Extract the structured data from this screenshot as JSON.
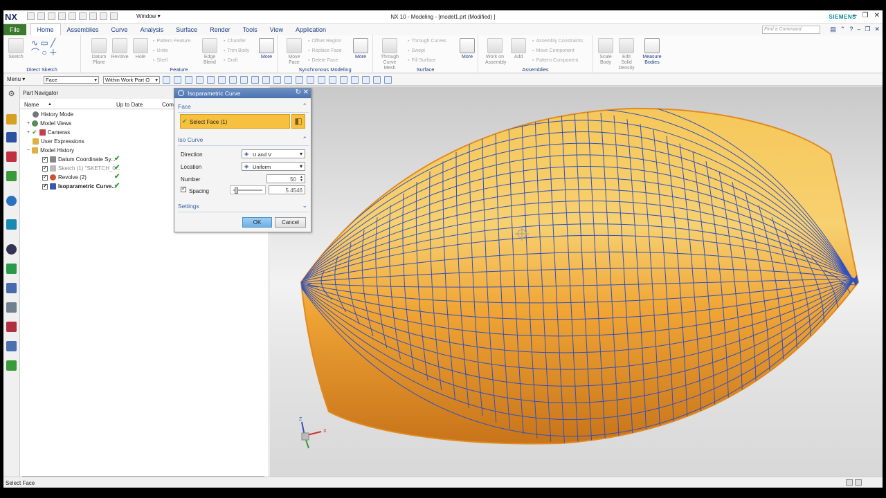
{
  "titlebar": {
    "logo": "NX",
    "window_menu": "Window ▾",
    "app_title": "NX 10 - Modeling - [model1.prt (Modified) ]",
    "brand": "SIEMENS"
  },
  "tabs": [
    {
      "label": "File"
    },
    {
      "label": "Home"
    },
    {
      "label": "Assemblies"
    },
    {
      "label": "Curve"
    },
    {
      "label": "Analysis"
    },
    {
      "label": "Surface"
    },
    {
      "label": "Render"
    },
    {
      "label": "Tools"
    },
    {
      "label": "View"
    },
    {
      "label": "Application"
    }
  ],
  "find_command": {
    "placeholder": "Find a Command"
  },
  "ribbon": {
    "direct_sketch": {
      "sketch": "Sketch",
      "label": "Direct Sketch"
    },
    "feature": {
      "datum_plane": "Datum Plane",
      "revolve": "Revolve",
      "hole": "Hole",
      "pattern_feature": "Pattern Feature",
      "unite": "Unite",
      "shell": "Shell",
      "edge_blend": "Edge Blend",
      "chamfer": "Chamfer",
      "trim_body": "Trim Body",
      "draft": "Draft",
      "more": "More",
      "label": "Feature"
    },
    "sync": {
      "move_face": "Move Face",
      "offset_region": "Offset Region",
      "replace_face": "Replace Face",
      "delete_face": "Delete Face",
      "more": "More",
      "label": "Synchronous Modeling"
    },
    "surface": {
      "through_curve_mesh": "Through Curve Mesh",
      "through_curves": "Through Curves",
      "swept": "Swept",
      "fill_surface": "Fill Surface",
      "more": "More",
      "label": "Surface"
    },
    "assemblies": {
      "work_on_assembly": "Work on Assembly",
      "add": "Add",
      "assembly_constraints": "Assembly Constraints",
      "move_component": "Move Component",
      "pattern_component": "Pattern Component",
      "label": "Assemblies"
    },
    "scale_body": "Scale Body",
    "edit_solid_density": "Edit Solid Density",
    "measure_bodies": "Measure Bodies"
  },
  "toolbar": {
    "menu": "Menu ▾",
    "filter": "Face",
    "scope": "Within Work Part O"
  },
  "navigator": {
    "title": "Part Navigator",
    "columns": {
      "name": "Name",
      "up_to_date": "Up to Date",
      "comment": "Com"
    },
    "items": [
      {
        "label": "History Mode"
      },
      {
        "label": "Model Views"
      },
      {
        "label": "Cameras"
      },
      {
        "label": "User Expressions"
      },
      {
        "label": "Model History"
      },
      {
        "label": "Datum Coordinate Sy..."
      },
      {
        "label": "Sketch (1) \"SKETCH_0..."
      },
      {
        "label": "Revolve (2)"
      },
      {
        "label": "Isoparametric Curve..."
      }
    ],
    "check_mark": "✔"
  },
  "dialog": {
    "title": "Isoparametric Curve",
    "face_section": "Face",
    "select_face": "Select Face (1)",
    "iso_section": "Iso Curve",
    "direction_label": "Direction",
    "direction_value": "U and V",
    "location_label": "Location",
    "location_value": "Uniform",
    "number_label": "Number",
    "number_value": "50",
    "spacing_label": "Spacing",
    "spacing_value": "5.4546",
    "settings_section": "Settings",
    "ok": "OK",
    "cancel": "Cancel"
  },
  "status": {
    "text": "Select Face"
  },
  "colors": {
    "accent": "#3b7a2d",
    "brand": "#00889b",
    "face_select": "#f7c13f",
    "ok_button": "#6fb0e4",
    "iso_curve": "#3050c0",
    "body_orange": "#f0a030"
  }
}
